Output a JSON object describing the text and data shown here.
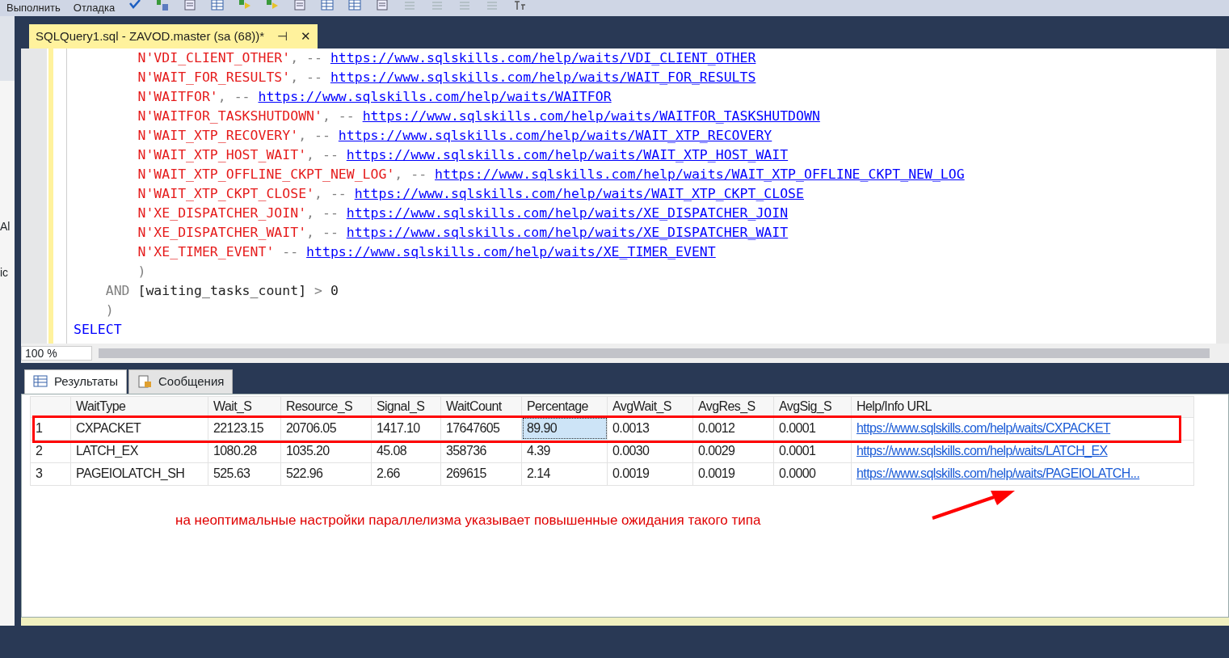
{
  "menu": [
    "Выполнить",
    "Отладка"
  ],
  "side_fragments": [
    "Al",
    "ic"
  ],
  "document_tab": {
    "title": "SQLQuery1.sql - ZAVOD.master (sa (68))*",
    "pin": "⊣",
    "close": "✕"
  },
  "code_lines": [
    {
      "kind": "inner",
      "segments": [
        {
          "kind": "string",
          "text": "N'VDI_CLIENT_OTHER'"
        },
        {
          "kind": "punct",
          "text": ", -- "
        },
        {
          "kind": "link",
          "text": "https://www.sqlskills.com/help/waits/VDI_CLIENT_OTHER"
        }
      ]
    },
    {
      "kind": "inner",
      "segments": [
        {
          "kind": "string",
          "text": "N'WAIT_FOR_RESULTS'"
        },
        {
          "kind": "punct",
          "text": ", -- "
        },
        {
          "kind": "link",
          "text": "https://www.sqlskills.com/help/waits/WAIT_FOR_RESULTS"
        }
      ]
    },
    {
      "kind": "inner",
      "segments": [
        {
          "kind": "string",
          "text": "N'WAITFOR'"
        },
        {
          "kind": "punct",
          "text": ", -- "
        },
        {
          "kind": "link",
          "text": "https://www.sqlskills.com/help/waits/WAITFOR"
        }
      ]
    },
    {
      "kind": "inner",
      "segments": [
        {
          "kind": "string",
          "text": "N'WAITFOR_TASKSHUTDOWN'"
        },
        {
          "kind": "punct",
          "text": ", -- "
        },
        {
          "kind": "link",
          "text": "https://www.sqlskills.com/help/waits/WAITFOR_TASKSHUTDOWN"
        }
      ]
    },
    {
      "kind": "inner",
      "segments": [
        {
          "kind": "string",
          "text": "N'WAIT_XTP_RECOVERY'"
        },
        {
          "kind": "punct",
          "text": ", -- "
        },
        {
          "kind": "link",
          "text": "https://www.sqlskills.com/help/waits/WAIT_XTP_RECOVERY"
        }
      ]
    },
    {
      "kind": "inner",
      "segments": [
        {
          "kind": "string",
          "text": "N'WAIT_XTP_HOST_WAIT'"
        },
        {
          "kind": "punct",
          "text": ", -- "
        },
        {
          "kind": "link",
          "text": "https://www.sqlskills.com/help/waits/WAIT_XTP_HOST_WAIT"
        }
      ]
    },
    {
      "kind": "inner",
      "segments": [
        {
          "kind": "string",
          "text": "N'WAIT_XTP_OFFLINE_CKPT_NEW_LOG'"
        },
        {
          "kind": "punct",
          "text": ", -- "
        },
        {
          "kind": "link",
          "text": "https://www.sqlskills.com/help/waits/WAIT_XTP_OFFLINE_CKPT_NEW_LOG"
        }
      ]
    },
    {
      "kind": "inner",
      "segments": [
        {
          "kind": "string",
          "text": "N'WAIT_XTP_CKPT_CLOSE'"
        },
        {
          "kind": "punct",
          "text": ", -- "
        },
        {
          "kind": "link",
          "text": "https://www.sqlskills.com/help/waits/WAIT_XTP_CKPT_CLOSE"
        }
      ]
    },
    {
      "kind": "inner",
      "segments": [
        {
          "kind": "string",
          "text": "N'XE_DISPATCHER_JOIN'"
        },
        {
          "kind": "punct",
          "text": ", -- "
        },
        {
          "kind": "link",
          "text": "https://www.sqlskills.com/help/waits/XE_DISPATCHER_JOIN"
        }
      ]
    },
    {
      "kind": "inner",
      "segments": [
        {
          "kind": "string",
          "text": "N'XE_DISPATCHER_WAIT'"
        },
        {
          "kind": "punct",
          "text": ", -- "
        },
        {
          "kind": "link",
          "text": "https://www.sqlskills.com/help/waits/XE_DISPATCHER_WAIT"
        }
      ]
    },
    {
      "kind": "inner",
      "segments": [
        {
          "kind": "string",
          "text": "N'XE_TIMER_EVENT'"
        },
        {
          "kind": "punct",
          "text": " -- "
        },
        {
          "kind": "link",
          "text": "https://www.sqlskills.com/help/waits/XE_TIMER_EVENT"
        }
      ]
    },
    {
      "kind": "inner",
      "segments": [
        {
          "kind": "punct",
          "text": ")"
        }
      ]
    },
    {
      "kind": "mid",
      "segments": [
        {
          "kind": "operator",
          "text": "AND"
        },
        {
          "kind": "ident",
          "text": " [waiting_tasks_count] "
        },
        {
          "kind": "operator",
          "text": ">"
        },
        {
          "kind": "ident",
          "text": " 0"
        }
      ]
    },
    {
      "kind": "mid",
      "segments": [
        {
          "kind": "punct",
          "text": ")"
        }
      ]
    },
    {
      "kind": "top",
      "segments": [
        {
          "kind": "keyword",
          "text": "SELECT"
        }
      ]
    }
  ],
  "zoom": "100 %",
  "result_tabs": [
    {
      "label": "Результаты",
      "kind": "grid",
      "selected": true
    },
    {
      "label": "Сообщения",
      "kind": "messages",
      "selected": false
    }
  ],
  "grid": {
    "columns": [
      "WaitType",
      "Wait_S",
      "Resource_S",
      "Signal_S",
      "WaitCount",
      "Percentage",
      "AvgWait_S",
      "AvgRes_S",
      "AvgSig_S",
      "Help/Info URL"
    ],
    "rows": [
      {
        "num": "1",
        "cells": [
          {
            "text": "CXPACKET",
            "selected": false
          },
          {
            "text": "22123.15",
            "selected": false
          },
          {
            "text": "20706.05",
            "selected": false
          },
          {
            "text": "1417.10",
            "selected": false
          },
          {
            "text": "17647605",
            "selected": false
          },
          {
            "text": "89.90",
            "selected": true
          },
          {
            "text": "0.0013",
            "selected": false
          },
          {
            "text": "0.0012",
            "selected": false
          },
          {
            "text": "0.0001",
            "selected": false
          },
          {
            "text": "https://www.sqlskills.com/help/waits/CXPACKET",
            "selected": false
          }
        ]
      },
      {
        "num": "2",
        "cells": [
          {
            "text": "LATCH_EX",
            "selected": false
          },
          {
            "text": "1080.28",
            "selected": false
          },
          {
            "text": "1035.20",
            "selected": false
          },
          {
            "text": "45.08",
            "selected": false
          },
          {
            "text": "358736",
            "selected": false
          },
          {
            "text": "4.39",
            "selected": false
          },
          {
            "text": "0.0030",
            "selected": false
          },
          {
            "text": "0.0029",
            "selected": false
          },
          {
            "text": "0.0001",
            "selected": false
          },
          {
            "text": "https://www.sqlskills.com/help/waits/LATCH_EX",
            "selected": false
          }
        ]
      },
      {
        "num": "3",
        "cells": [
          {
            "text": "PAGEIOLATCH_SH",
            "selected": false
          },
          {
            "text": "525.63",
            "selected": false
          },
          {
            "text": "522.96",
            "selected": false
          },
          {
            "text": "2.66",
            "selected": false
          },
          {
            "text": "269615",
            "selected": false
          },
          {
            "text": "2.14",
            "selected": false
          },
          {
            "text": "0.0019",
            "selected": false
          },
          {
            "text": "0.0019",
            "selected": false
          },
          {
            "text": "0.0000",
            "selected": false
          },
          {
            "text": "https://www.sqlskills.com/help/waits/PAGEIOLATCH...",
            "selected": false
          }
        ]
      }
    ]
  },
  "annotation": {
    "text": "на неоптимальные настройки параллелизма указывает повышенные ожидания такого типа"
  }
}
